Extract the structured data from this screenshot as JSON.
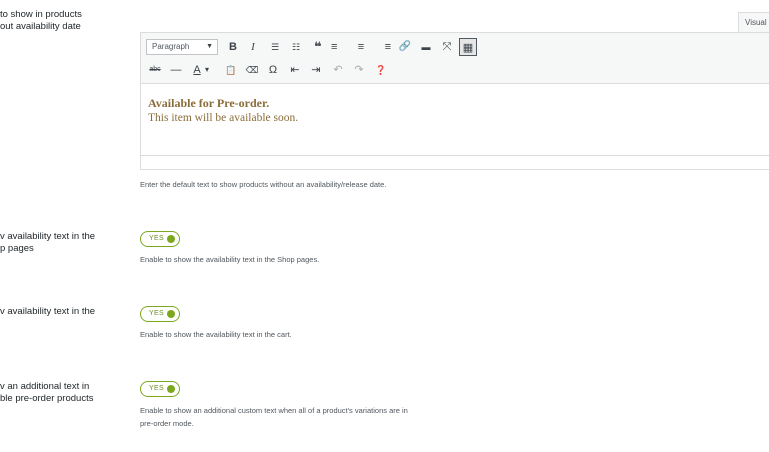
{
  "colors": {
    "accent_green": "#7ca81e",
    "preorder_text": "#8a6d3b",
    "active_button_border": "#50575e"
  },
  "fields": {
    "default_text": {
      "label": "to show in products\nout availability date",
      "description": "Enter the default text to show products without an availability/release date."
    },
    "shop_pages": {
      "label": "v availability text in the\np pages",
      "toggle": {
        "value": "YES",
        "on": true
      },
      "description": "Enable to show the availability text in the Shop pages."
    },
    "cart": {
      "label": "v availability text in the",
      "toggle": {
        "value": "YES",
        "on": true
      },
      "description": "Enable to show the availability text in the cart."
    },
    "additional": {
      "label": "v an additional text in\nble pre-order products",
      "toggle": {
        "value": "YES",
        "on": true
      },
      "description": "Enable to show an additional custom text when all of a product's variations are in\npre-order mode."
    }
  },
  "editor": {
    "tab_visual": "Visual",
    "format_select": "Paragraph",
    "toolbar_row1": [
      {
        "name": "bold-icon",
        "glyph": "B"
      },
      {
        "name": "italic-icon",
        "glyph": "I"
      },
      {
        "name": "bulleted-list-icon",
        "glyph": "☰"
      },
      {
        "name": "numbered-list-icon",
        "glyph": "☷"
      },
      {
        "name": "blockquote-icon",
        "glyph": "❝"
      },
      {
        "name": "align-left-icon",
        "glyph": "≡"
      },
      {
        "name": "align-center-icon",
        "glyph": "≡"
      },
      {
        "name": "align-right-icon",
        "glyph": "≡"
      },
      {
        "name": "link-icon",
        "glyph": "🔗"
      },
      {
        "name": "read-more-icon",
        "glyph": "▬"
      },
      {
        "name": "fullscreen-icon",
        "glyph": "⤧"
      },
      {
        "name": "toolbar-toggle-icon",
        "glyph": "▦",
        "active": true
      }
    ],
    "toolbar_row2": [
      {
        "name": "strikethrough-icon",
        "glyph": "abc"
      },
      {
        "name": "horizontal-line-icon",
        "glyph": "—"
      },
      {
        "name": "text-color-icon",
        "glyph": "A"
      },
      {
        "name": "text-color-dropdown-icon",
        "glyph": "▾"
      },
      {
        "name": "paste-as-text-icon",
        "glyph": "📋"
      },
      {
        "name": "clear-formatting-icon",
        "glyph": "⌫"
      },
      {
        "name": "special-character-icon",
        "glyph": "Ω"
      },
      {
        "name": "outdent-icon",
        "glyph": "⇤"
      },
      {
        "name": "indent-icon",
        "glyph": "⇥"
      },
      {
        "name": "undo-icon",
        "glyph": "↶"
      },
      {
        "name": "redo-icon",
        "glyph": "↷"
      },
      {
        "name": "help-icon",
        "glyph": "❓"
      }
    ],
    "content": {
      "title": "Available for Pre-order.",
      "body": "This item will be available soon."
    }
  }
}
